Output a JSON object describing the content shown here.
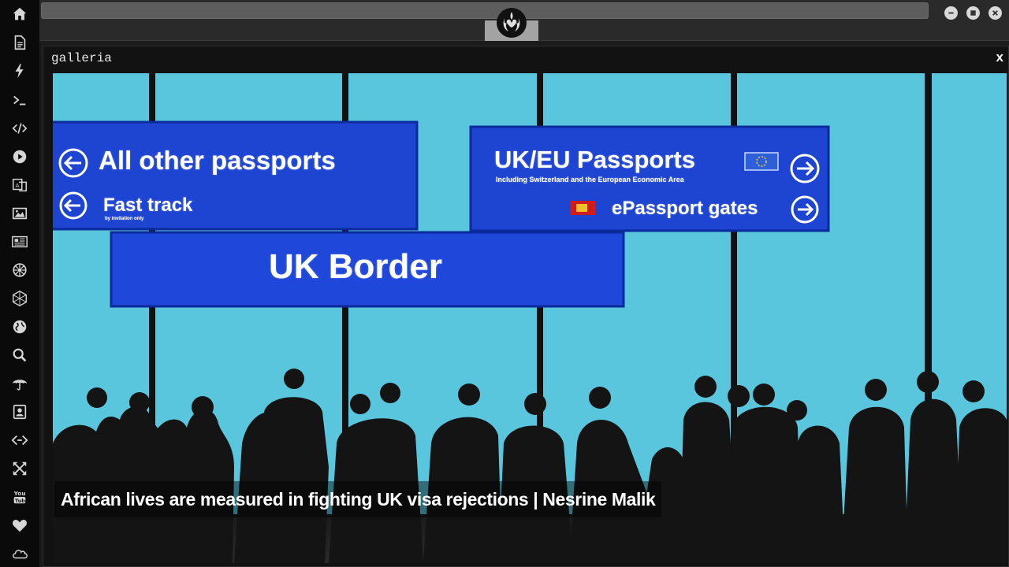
{
  "sidebar": {
    "items": [
      {
        "icon": "home-icon"
      },
      {
        "icon": "document-icon"
      },
      {
        "icon": "lightning-icon"
      },
      {
        "icon": "terminal-icon"
      },
      {
        "icon": "code-icon"
      },
      {
        "icon": "play-icon"
      },
      {
        "icon": "translate-icon"
      },
      {
        "icon": "image-icon"
      },
      {
        "icon": "newspaper-icon"
      },
      {
        "icon": "settings-wheel-icon"
      },
      {
        "icon": "hexagon-network-icon"
      },
      {
        "icon": "globe-icon"
      },
      {
        "icon": "search-icon"
      },
      {
        "icon": "umbrella-icon"
      },
      {
        "icon": "contact-card-icon"
      },
      {
        "icon": "link-code-icon"
      },
      {
        "icon": "expand-arrows-icon"
      },
      {
        "icon": "youtube-icon"
      },
      {
        "icon": "heart-icon"
      },
      {
        "icon": "cloud-icon"
      }
    ]
  },
  "window": {
    "logo_icon": "rebel-alliance-logo-icon",
    "controls": [
      "minimize",
      "maximize",
      "close"
    ]
  },
  "panel": {
    "title": "galleria",
    "close_label": "x"
  },
  "photo": {
    "signs": {
      "left_main": "All other passports",
      "left_sub": "Fast track",
      "left_small": "by invitation only",
      "right_main": "UK/EU Passports",
      "right_sub": "Including Switzerland and the European Economic Area",
      "right_gates": "ePassport gates",
      "border": "UK Border"
    },
    "caption": "African lives are measured in fighting UK visa rejections | Nesrine Malik"
  },
  "colors": {
    "sidebar_bg": "#0a0a0a",
    "topbar_bg": "#2a2a2a",
    "sky": "#5ac6de",
    "sign_blue": "#1f46d6",
    "silhouette": "#141414"
  }
}
